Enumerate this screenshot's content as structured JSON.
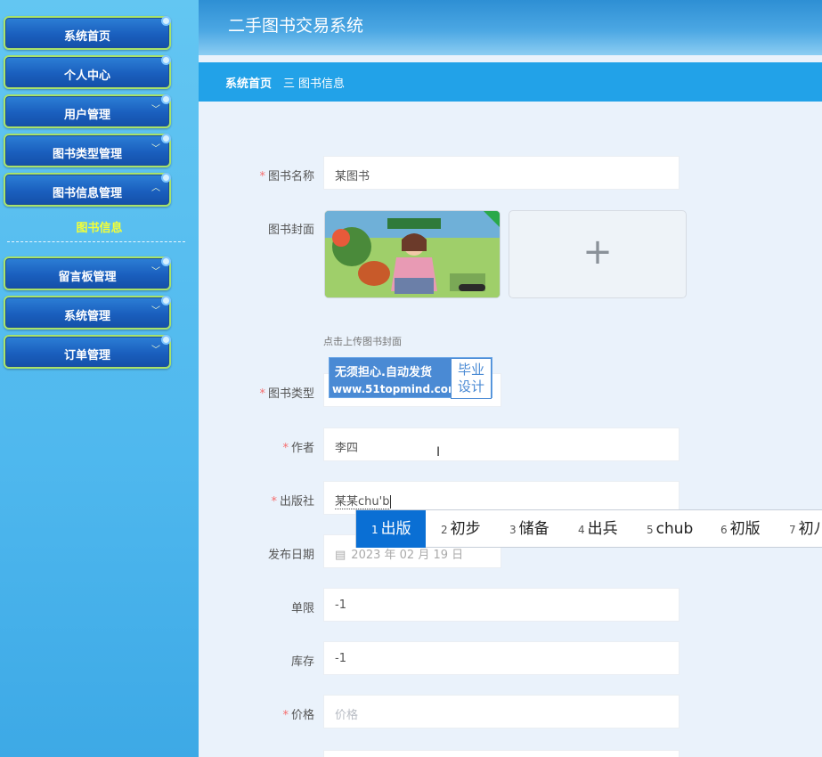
{
  "sidebar": {
    "items": [
      {
        "label": "系统首页"
      },
      {
        "label": "个人中心"
      },
      {
        "label": "用户管理"
      },
      {
        "label": "图书类型管理"
      },
      {
        "label": "图书信息管理"
      },
      {
        "label": "留言板管理"
      },
      {
        "label": "系统管理"
      },
      {
        "label": "订单管理"
      }
    ],
    "active_sub": "图书信息"
  },
  "header": {
    "title": "二手图书交易系统"
  },
  "breadcrumb": {
    "home": "系统首页",
    "separator": "三",
    "current": "图书信息"
  },
  "form": {
    "book_name": {
      "label": "图书名称",
      "value": "某图书"
    },
    "cover": {
      "label": "图书封面",
      "hint": "点击上传图书封面",
      "plus": "+"
    },
    "book_type": {
      "label": "图书类型"
    },
    "author": {
      "label": "作者",
      "value": "李四"
    },
    "publisher": {
      "label": "出版社",
      "value": "某某chu'b"
    },
    "publish_date": {
      "label": "发布日期",
      "value": "2023 年 02 月 19 日"
    },
    "limit": {
      "label": "单限",
      "value": "-1"
    },
    "stock": {
      "label": "库存",
      "value": "-1"
    },
    "price": {
      "label": "价格",
      "placeholder": "价格"
    }
  },
  "watermark": {
    "line1": "无须担心.自动发货",
    "line2": "www.51topmind.com",
    "box": "毕业设计"
  },
  "ime": {
    "candidates": [
      {
        "n": "1",
        "text": "出版"
      },
      {
        "n": "2",
        "text": "初步"
      },
      {
        "n": "3",
        "text": "储备"
      },
      {
        "n": "4",
        "text": "出兵"
      },
      {
        "n": "5",
        "text": "chub"
      },
      {
        "n": "6",
        "text": "初版"
      },
      {
        "n": "7",
        "text": "初八"
      }
    ]
  },
  "colors": {
    "required": "#f56c6c",
    "breadcrumb_bg": "#22a2e8",
    "active_sub": "#f3ff36",
    "ime_selected": "#0a6fd4"
  }
}
